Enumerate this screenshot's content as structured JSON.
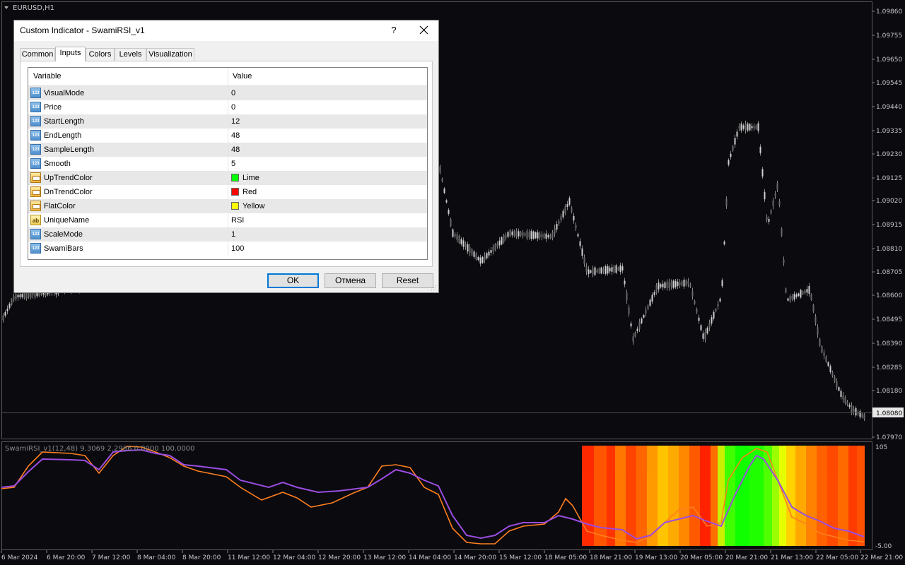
{
  "chart": {
    "symbol_label": "EURUSD,H1",
    "price_ticks": [
      "1.09860",
      "1.09755",
      "1.09650",
      "1.09545",
      "1.09440",
      "1.09335",
      "1.09230",
      "1.09125",
      "1.09020",
      "1.08915",
      "1.08810",
      "1.08705",
      "1.08600",
      "1.08495",
      "1.08390",
      "1.08285",
      "1.08180",
      "1.07970"
    ],
    "current_price": "1.08080",
    "time_ticks": [
      "6 Mar 2024",
      "6 Mar 20:00",
      "7 Mar 12:00",
      "8 Mar 04:00",
      "8 Mar 20:00",
      "11 Mar 12:00",
      "12 Mar 04:00",
      "12 Mar 20:00",
      "13 Mar 12:00",
      "14 Mar 04:00",
      "14 Mar 20:00",
      "15 Mar 12:00",
      "18 Mar 05:00",
      "18 Mar 21:00",
      "19 Mar 13:00",
      "20 Mar 05:00",
      "20 Mar 21:00",
      "21 Mar 13:00",
      "22 Mar 05:00",
      "22 Mar 21:00"
    ]
  },
  "indicator": {
    "label": "SwamiRSI_v1(12,48) 9.3069 2.2986 0.0000 100.0000",
    "scale_top": "105",
    "scale_bottom": "-5.00"
  },
  "dialog": {
    "title": "Custom Indicator - SwamiRSI_v1",
    "help": "?",
    "tabs": [
      "Common",
      "Inputs",
      "Colors",
      "Levels",
      "Visualization"
    ],
    "active_tab": "Inputs",
    "columns": {
      "variable": "Variable",
      "value": "Value"
    },
    "rows": [
      {
        "type": "num",
        "name": "VisualMode",
        "value": "0"
      },
      {
        "type": "num",
        "name": "Price",
        "value": "0"
      },
      {
        "type": "num",
        "name": "StartLength",
        "value": "12"
      },
      {
        "type": "num",
        "name": "EndLength",
        "value": "48"
      },
      {
        "type": "num",
        "name": "SampleLength",
        "value": "48"
      },
      {
        "type": "num",
        "name": "Smooth",
        "value": "5"
      },
      {
        "type": "color",
        "name": "UpTrendColor",
        "value": "Lime",
        "color": "#00ff00"
      },
      {
        "type": "color",
        "name": "DnTrendColor",
        "value": "Red",
        "color": "#ff0000"
      },
      {
        "type": "color",
        "name": "FlatColor",
        "value": "Yellow",
        "color": "#ffff00"
      },
      {
        "type": "str",
        "name": "UniqueName",
        "value": "RSI"
      },
      {
        "type": "num",
        "name": "ScaleMode",
        "value": "1"
      },
      {
        "type": "num",
        "name": "SwamiBars",
        "value": "100"
      }
    ],
    "icons": {
      "num": "123",
      "str": "ab"
    },
    "buttons": {
      "ok": "OK",
      "cancel": "Отмена",
      "reset": "Reset"
    }
  }
}
